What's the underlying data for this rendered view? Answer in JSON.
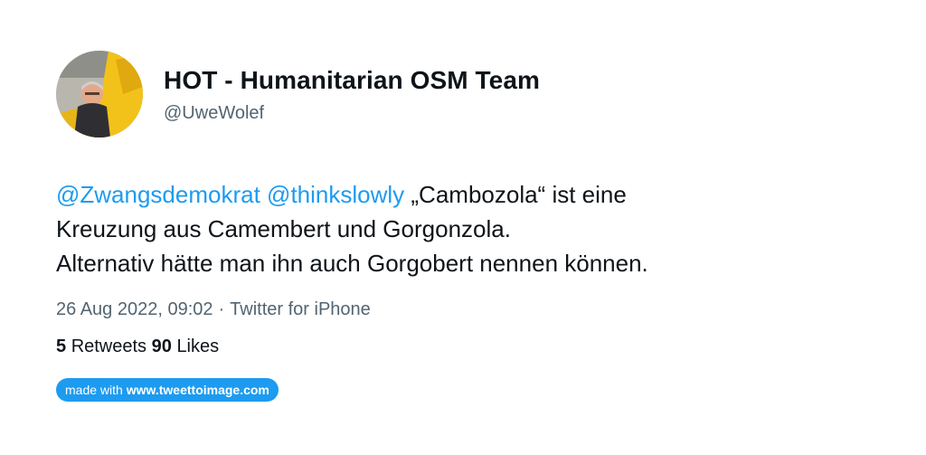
{
  "author": {
    "display_name": "HOT - Humanitarian OSM Team",
    "handle": "@UweWolef",
    "avatar_icon": "user-photo-avatar"
  },
  "tweet": {
    "mentions": [
      "@Zwangsdemokrat",
      "@thinkslowly"
    ],
    "line1_rest": "„Cambozola“ ist eine",
    "line2": "Kreuzung aus Camembert und Gorgonzola.",
    "line3": "Alternativ hätte man ihn auch Gorgobert nennen können."
  },
  "meta": {
    "timestamp": "26 Aug 2022, 09:02",
    "separator": "·",
    "source": "Twitter for iPhone"
  },
  "stats": {
    "retweets_count": "5",
    "retweets_label": "Retweets",
    "likes_count": "90",
    "likes_label": "Likes"
  },
  "badge": {
    "prefix": "made with",
    "site": "www.tweettoimage.com"
  },
  "colors": {
    "mention": "#1d9bf0",
    "badge_bg": "#1d9bf0",
    "muted_text": "#536471",
    "main_text": "#0f1419"
  }
}
